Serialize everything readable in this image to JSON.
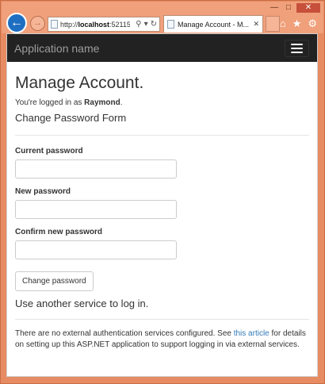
{
  "browser": {
    "address_prefix": "http://",
    "address_host": "localhost",
    "address_rest": ":52115",
    "tab_title": "Manage Account - M..."
  },
  "app": {
    "brand": "Application name"
  },
  "page": {
    "title": "Manage Account.",
    "login_prefix": "You're logged in as ",
    "username": "Raymond",
    "login_suffix": ".",
    "form_heading": "Change Password Form",
    "fields": [
      {
        "label": "Current password",
        "value": ""
      },
      {
        "label": "New password",
        "value": ""
      },
      {
        "label": "Confirm new password",
        "value": ""
      }
    ],
    "submit_label": "Change password",
    "alt_heading": "Use another service to log in.",
    "ext_text_before": "There are no external authentication services configured. See ",
    "ext_link": "this article",
    "ext_text_after": " for details on setting up this ASP.NET application to support logging in via external services."
  },
  "colors": {
    "navbar": "#222222",
    "brand_text": "#9d9d9d",
    "link": "#337ab7",
    "frame": "#e78b63",
    "back_button": "#1e6fc1"
  }
}
